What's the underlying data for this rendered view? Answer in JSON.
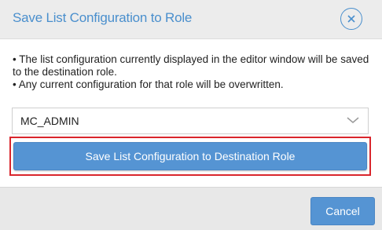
{
  "dialog": {
    "title": "Save List Configuration to Role",
    "close_icon": "close-circle-icon"
  },
  "notes": [
    "• The list configuration currently displayed in the editor window will be saved to the destination role.",
    "• Any current configuration for that role will be overwritten."
  ],
  "role_select": {
    "value": "MC_ADMIN",
    "chevron_icon": "chevron-down-icon"
  },
  "save_button": {
    "label": "Save List Configuration to Destination Role"
  },
  "footer": {
    "cancel_label": "Cancel"
  },
  "colors": {
    "accent": "#4a8fcd",
    "button": "#5594d3",
    "highlight": "#d9252c",
    "header_bg": "#ececec",
    "footer_bg": "#e8e8e8"
  }
}
